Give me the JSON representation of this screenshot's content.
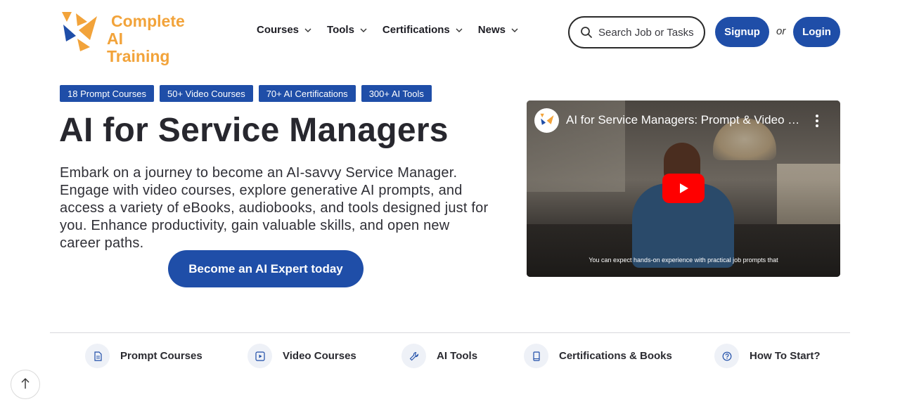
{
  "brand": {
    "line1": "Complete",
    "line2": "AI Training",
    "orange": "#f2a33a",
    "blue": "#1f4ea8"
  },
  "nav": {
    "items": [
      {
        "label": "Courses"
      },
      {
        "label": "Tools"
      },
      {
        "label": "Certifications"
      },
      {
        "label": "News"
      }
    ]
  },
  "search": {
    "placeholder": "Search Job or Tasks"
  },
  "auth": {
    "signup": "Signup",
    "or": "or",
    "login": "Login"
  },
  "tags": [
    "18 Prompt Courses",
    "50+ Video Courses",
    "70+ AI Certifications",
    "300+ AI Tools"
  ],
  "hero": {
    "title": "AI for Service Managers",
    "description": "Embark on a journey to become an AI-savvy Service Manager. Engage with video courses, explore generative AI prompts, and access a variety of eBooks, audiobooks, and tools designed just for you. Enhance productivity, gain valuable skills, and open new career paths.",
    "cta": "Become an AI Expert today"
  },
  "video": {
    "title": "AI for Service Managers: Prompt & Video cou...",
    "caption": "You can expect hands-on experience with practical job prompts that"
  },
  "bottom_nav": [
    {
      "label": "Prompt Courses",
      "icon": "document-icon"
    },
    {
      "label": "Video Courses",
      "icon": "play-square-icon"
    },
    {
      "label": "AI Tools",
      "icon": "wrench-icon"
    },
    {
      "label": "Certifications & Books",
      "icon": "book-icon"
    },
    {
      "label": "How To Start?",
      "icon": "question-circle-icon"
    }
  ]
}
